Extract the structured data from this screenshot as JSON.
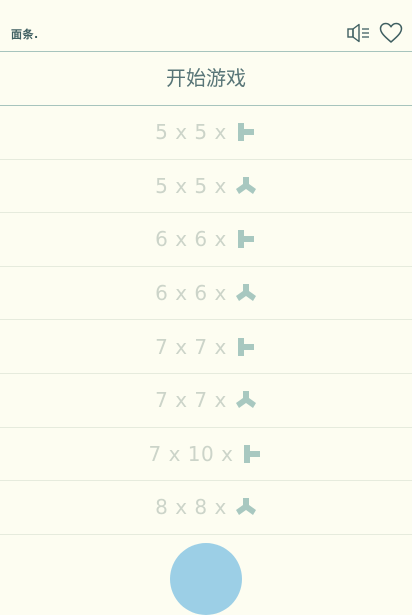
{
  "app": {
    "brand": "面条."
  },
  "header": {
    "title": "开始游戏"
  },
  "levels": [
    {
      "label": "5 x 5 x",
      "piece": "t-piece-icon"
    },
    {
      "label": "5 x 5 x",
      "piece": "y-piece-icon"
    },
    {
      "label": "6 x 6 x",
      "piece": "t-piece-icon"
    },
    {
      "label": "6 x 6 x",
      "piece": "y-piece-icon"
    },
    {
      "label": "7 x 7 x",
      "piece": "t-piece-icon"
    },
    {
      "label": "7 x 7 x",
      "piece": "y-piece-icon"
    },
    {
      "label": "7 x 10 x",
      "piece": "t-piece-icon"
    },
    {
      "label": "8 x 8 x",
      "piece": "y-piece-icon"
    }
  ],
  "colors": {
    "background": "#fdfdf1",
    "accent": "#3f5f61",
    "separator": "#a7c4bd",
    "row_text": "#ccd4c9",
    "piece": "#a8c8c0",
    "fab": "#9ccfe6"
  }
}
